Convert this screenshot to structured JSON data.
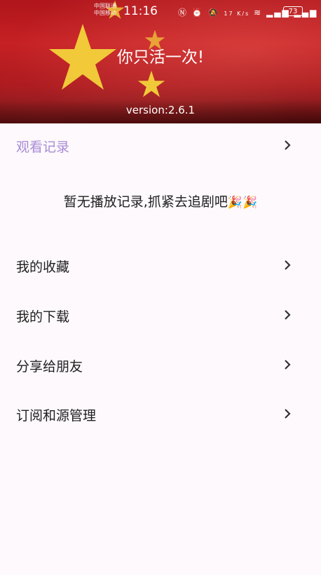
{
  "status_bar": {
    "carrier_line1": "中国联通",
    "carrier_line2": "中国移动",
    "time": "11:16",
    "speed": "17 K/s",
    "battery": "73",
    "icons": [
      "nfc-icon",
      "alarm-icon",
      "mute-icon",
      "wifi-icon",
      "signal-5g-icon",
      "signal-4g-icon"
    ]
  },
  "header": {
    "title": "你只活一次!",
    "version": "version:2.6.1",
    "background": "chinese-flag"
  },
  "history": {
    "label": "观看记录",
    "empty_text": "暂无播放记录,抓紧去追剧吧",
    "emoji": "🎉🎉",
    "accent_color": "#a98bd6"
  },
  "menu": [
    {
      "label": "我的收藏"
    },
    {
      "label": "我的下载"
    },
    {
      "label": "分享给朋友"
    },
    {
      "label": "订阅和源管理"
    }
  ]
}
